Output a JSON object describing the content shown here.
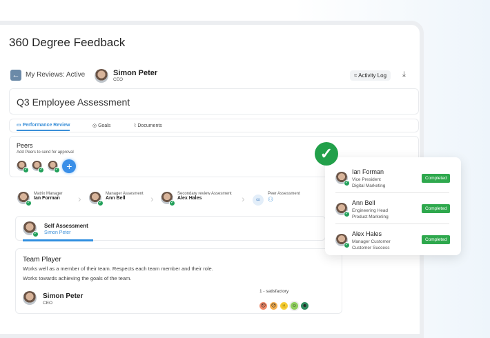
{
  "page_title": "360 Degree Feedback",
  "header": {
    "back_label": "My Reviews: Active",
    "user_name": "Simon Peter",
    "user_role": "CEO",
    "activity_log": "Activity Log"
  },
  "assessment_title": "Q3 Employee Assessment",
  "tabs": [
    {
      "label": "Performance Review"
    },
    {
      "label": "Goals"
    },
    {
      "label": "Documents"
    }
  ],
  "peers": {
    "title": "Peers",
    "subtitle": "Add Peers to send for approval"
  },
  "steps": [
    {
      "role": "Matrix Manager",
      "name": "Ian Forman"
    },
    {
      "role": "Manager Assesment",
      "name": "Ann Bell"
    },
    {
      "role": "Secondary review Assesment",
      "name": "Alex Hales"
    },
    {
      "role": "Peer Assessment"
    }
  ],
  "self_assessment": {
    "title": "Self Assessment",
    "name": "Simon Peter"
  },
  "question": {
    "title": "Team Player",
    "text1": "Works well as a member of their team. Respects each team member and their role.",
    "text2": "Works towards achieving the goals of the team.",
    "user_name": "Simon Peter",
    "user_role": "CEO",
    "rating": "1 - satisfactory"
  },
  "popup": [
    {
      "name": "Ian Forman",
      "line1": "Vice President",
      "line2": "Digital Marketing",
      "status": "Completed"
    },
    {
      "name": "Ann Bell",
      "line1": "Engineering Head",
      "line2": "Product Marketing",
      "status": "Completed"
    },
    {
      "name": "Alex Hales",
      "line1": "Manager Customer",
      "line2": "Customer Success",
      "status": "Completed"
    }
  ]
}
